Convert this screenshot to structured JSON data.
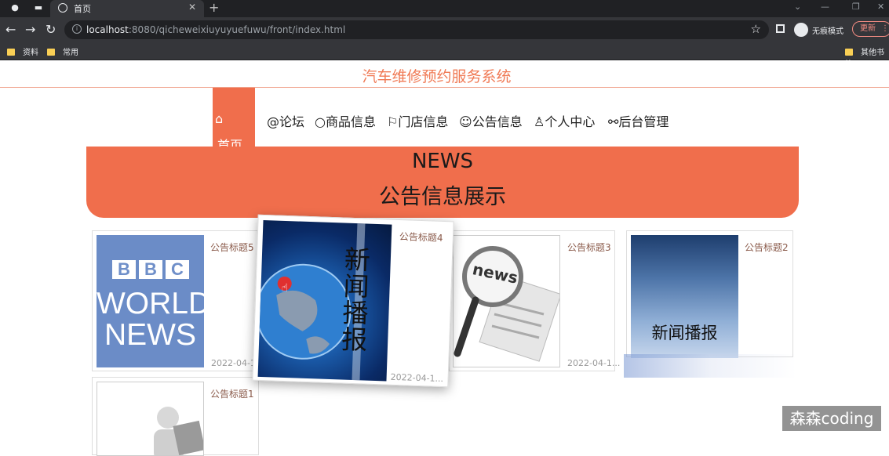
{
  "browser": {
    "tab_title": "首页",
    "address": {
      "host": "localhost",
      "path": ":8080/qicheweixiuyuyuefuwu/front/index.html"
    },
    "incognito_label": "无痕模式",
    "update_label": "更新",
    "bookmarks": [
      "资料",
      "常用"
    ],
    "other_bookmarks": "其他书签"
  },
  "site": {
    "title": "汽车维修预约服务系统"
  },
  "nav": {
    "items": [
      {
        "icon": "home-icon",
        "label": "首页",
        "active": true
      },
      {
        "icon": "forum-icon",
        "label": "论坛"
      },
      {
        "icon": "product-icon",
        "label": "商品信息"
      },
      {
        "icon": "flag-icon",
        "label": "门店信息"
      },
      {
        "icon": "notice-icon",
        "label": "公告信息"
      },
      {
        "icon": "user-icon",
        "label": "个人中心"
      },
      {
        "icon": "link-icon",
        "label": "后台管理"
      }
    ]
  },
  "banner": {
    "en": "NEWS",
    "cn": "公告信息展示"
  },
  "news": [
    {
      "title": "公告标题5",
      "date": "2022-04-1...",
      "image": "bbc-world-news-image",
      "image_text": {
        "brand": [
          "B",
          "B",
          "C"
        ],
        "line1": "WORLD",
        "line2": "NEWS"
      }
    },
    {
      "title": "公告标题4",
      "date": "2022-04-1...",
      "image": "globe-news-broadcast-image",
      "image_text": "新闻播报"
    },
    {
      "title": "公告标题3",
      "date": "2022-04-1...",
      "image": "newspaper-magnifier-image",
      "image_text": "news"
    },
    {
      "title": "公告标题2",
      "date": "",
      "image": "sky-news-broadcast-image",
      "image_text": "新闻播报"
    },
    {
      "title": "公告标题1",
      "date": "",
      "image": "reader-figure-image"
    }
  ],
  "watermark": "森森coding",
  "colors": {
    "accent": "#f06e4c",
    "title": "#f07a55",
    "chrome_dark": "#202124",
    "chrome": "#35363a"
  }
}
